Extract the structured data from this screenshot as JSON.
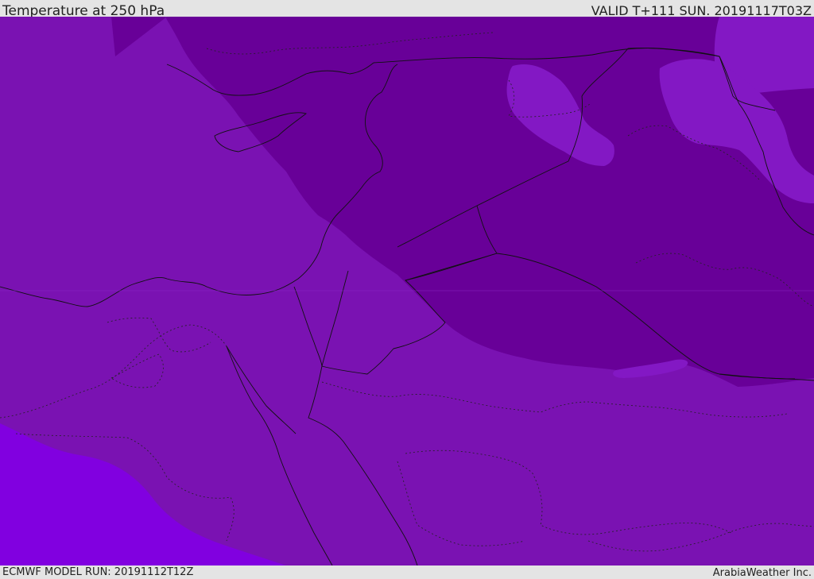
{
  "header": {
    "title": "Temperature at 250 hPa",
    "valid": "VALID T+111 SUN. 20191117T03Z"
  },
  "footer": {
    "model_run": "ECMWF MODEL RUN: 20191112T12Z",
    "credit": "ArabiaWeather Inc."
  },
  "map": {
    "fill_colors": {
      "base": "#7a12b2",
      "cold": "#680098",
      "warm": "#8100e0",
      "lighter": "#8318c4"
    }
  }
}
